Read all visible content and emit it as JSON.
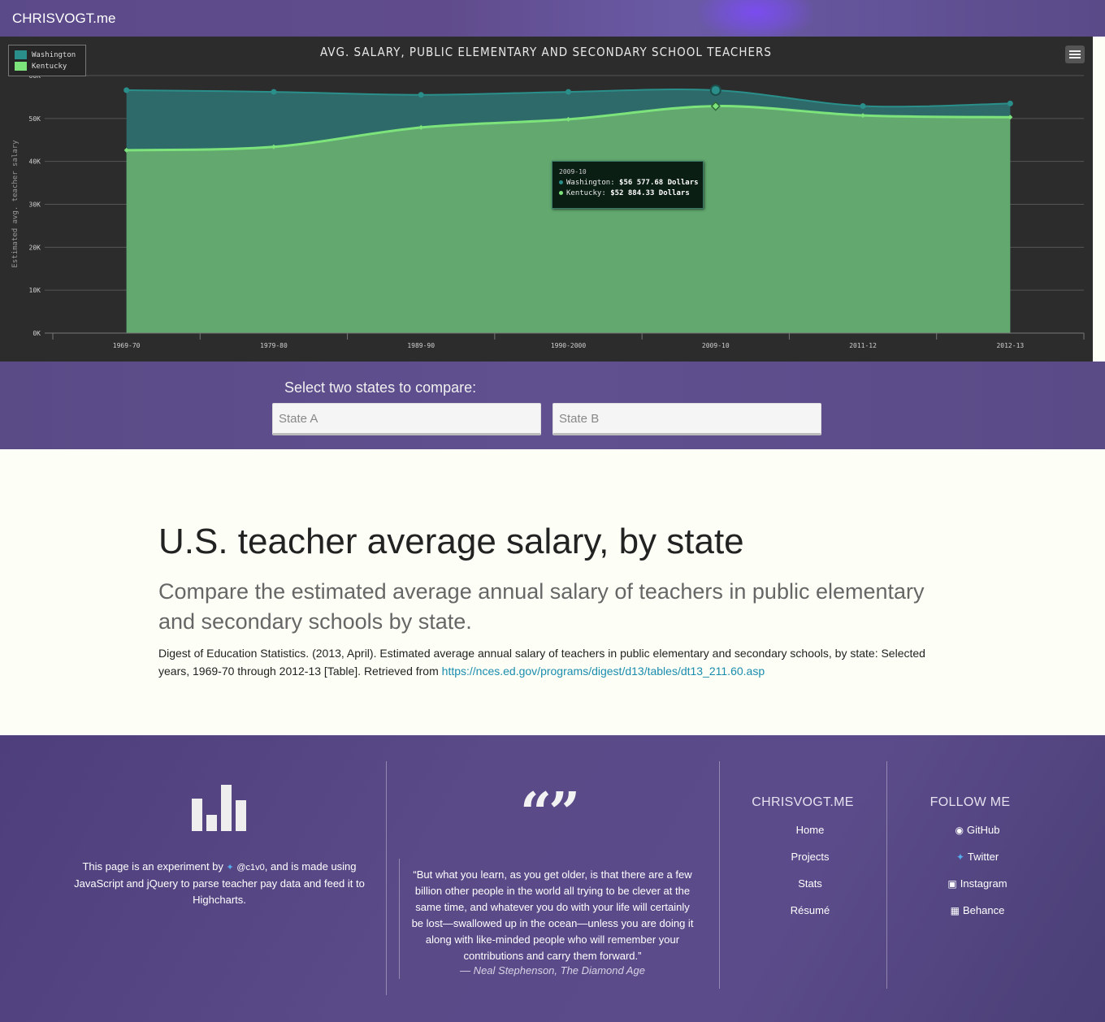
{
  "topbar": {
    "brand": "CHRISVOGT.me"
  },
  "chart_data": {
    "type": "area",
    "title": "AVG. SALARY, PUBLIC ELEMENTARY AND SECONDARY SCHOOL TEACHERS",
    "ylabel": "Estimated avg. teacher salary",
    "xlabel": "",
    "categories": [
      "1969-70",
      "1979-80",
      "1989-90",
      "1990-2000",
      "2009-10",
      "2011-12",
      "2012-13"
    ],
    "y_ticks": [
      "0K",
      "10K",
      "20K",
      "30K",
      "40K",
      "50K",
      "60K"
    ],
    "ylim": [
      0,
      60000
    ],
    "grid": true,
    "legend_position": "top-left",
    "series": [
      {
        "name": "Washington",
        "color": "#2a8f8a",
        "values": [
          56600,
          56200,
          55500,
          56200,
          56577.68,
          52900,
          53500
        ]
      },
      {
        "name": "Kentucky",
        "color": "#7de37b",
        "values": [
          42600,
          43400,
          47900,
          49800,
          52884.33,
          50700,
          50300
        ]
      }
    ],
    "tooltip": {
      "category": "2009-10",
      "rows": [
        {
          "name": "Washington",
          "value": "$56 577.68 Dollars"
        },
        {
          "name": "Kentucky",
          "value": "$52 884.33 Dollars"
        }
      ]
    }
  },
  "select": {
    "label": "Select two states to compare:",
    "state_a_placeholder": "State A",
    "state_b_placeholder": "State B"
  },
  "content": {
    "title": "U.S. teacher average salary, by state",
    "subtitle": "Compare the estimated average annual salary of teachers in public elementary and secondary schools by state.",
    "citation_text": "Digest of Education Statistics. (2013, April). Estimated average annual salary of teachers in public elementary and secondary schools, by state: Selected years, 1969-70 through 2012-13 [Table]. Retrieved from ",
    "citation_link": "https://nces.ed.gov/programs/digest/d13/tables/dt13_211.60.asp"
  },
  "footer": {
    "about_prefix": "This page is an experiment by ",
    "about_handle": "@c1v0",
    "about_suffix": ", and is made using JavaScript and jQuery to parse teacher pay data and feed it to Highcharts.",
    "quote_mark": "“”",
    "quote": "“But what you learn, as you get older, is that there are a few billion other people in the world all trying to be clever at the same time, and whatever you do with your life will certainly be lost—swallowed up in the ocean—unless you are doing it along with like-minded people who will remember your contributions and carry them forward.”",
    "quote_cite": "— Neal Stephenson, The Diamond Age",
    "site_title": "CHRISVOGT.ME",
    "site_links": [
      "Home",
      "Projects",
      "Stats",
      "Résumé"
    ],
    "follow_title": "FOLLOW ME",
    "follow_links": [
      {
        "label": "GitHub",
        "icon": "github-icon"
      },
      {
        "label": "Twitter",
        "icon": "twitter-icon"
      },
      {
        "label": "Instagram",
        "icon": "instagram-icon"
      },
      {
        "label": "Behance",
        "icon": "behance-icon"
      }
    ]
  }
}
